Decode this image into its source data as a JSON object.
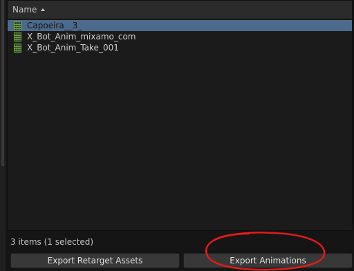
{
  "list": {
    "column_header": "Name",
    "items": [
      {
        "label": "Capoeira__3_",
        "selected": true
      },
      {
        "label": "X_Bot_Anim_mixamo_com",
        "selected": false
      },
      {
        "label": "X_Bot_Anim_Take_001",
        "selected": false
      }
    ]
  },
  "status_text": "3 items (1 selected)",
  "buttons": {
    "export_retarget": "Export Retarget Assets",
    "export_animations": "Export Animations"
  },
  "colors": {
    "selection": "#4b6a8c",
    "asset_icon": "#6fa34b",
    "annotation": "#e01b1b"
  },
  "icons": {
    "sort": "sort-ascending-icon",
    "asset": "animation-asset-icon"
  }
}
